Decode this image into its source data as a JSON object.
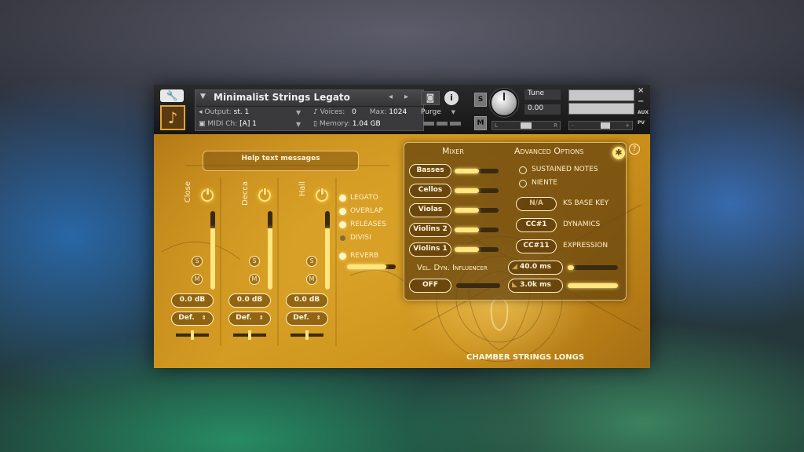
{
  "header": {
    "instrument_name": "Minimalist Strings Legato",
    "nav_prev": "◂",
    "nav_next": "▸",
    "output_label": "Output:",
    "output_value": "st. 1",
    "midi_label": "MIDI Ch:",
    "midi_value": "[A] 1",
    "voices_label": "Voices:",
    "voices_value": "0",
    "max_label": "Max:",
    "max_value": "1024",
    "memory_label": "Memory:",
    "memory_value": "1.04 GB",
    "purge_label": "Purge",
    "solo_label": "S",
    "mute_label": "M",
    "tune_label": "Tune",
    "tune_value": "0.00",
    "pan_left": "L",
    "pan_right": "R",
    "vol_minus": "-",
    "vol_plus": "+",
    "close_x": "×",
    "minimize": "−",
    "aux_label": "AUX",
    "pv_label": "PV"
  },
  "help": {
    "text": "Help text messages"
  },
  "mics": [
    {
      "name": "Close",
      "level": 0.78,
      "db": "0.0 dB",
      "preset": "Def."
    },
    {
      "name": "Decca",
      "level": 0.78,
      "db": "0.0 dB",
      "preset": "Def."
    },
    {
      "name": "Hall",
      "level": 0.78,
      "db": "0.0 dB",
      "preset": "Def."
    }
  ],
  "mic_solo": "S",
  "mic_mute": "M",
  "options": [
    {
      "label": "LEGATO",
      "on": true
    },
    {
      "label": "OVERLAP",
      "on": true
    },
    {
      "label": "RELEASES",
      "on": true
    },
    {
      "label": "DIVISI",
      "on": false
    },
    {
      "label": "REVERB",
      "on": true
    }
  ],
  "reverb_level": 0.8,
  "mixer": {
    "title": "Mixer",
    "sections": [
      {
        "label": "Basses",
        "level": 0.55
      },
      {
        "label": "Cellos",
        "level": 0.55
      },
      {
        "label": "Violas",
        "level": 0.55
      },
      {
        "label": "Violins 2",
        "level": 0.55
      },
      {
        "label": "Violins 1",
        "level": 0.55
      }
    ],
    "influencer_label": "Vel. Dyn. Influencer",
    "influencer_value": "OFF"
  },
  "advanced": {
    "title": "Advanced Options",
    "radio_sustained": "SUSTAINED NOTES",
    "radio_niente": "NIENTE",
    "ks_value": "N/A",
    "ks_label": "KS BASE KEY",
    "dynamics_cc": "CC#1",
    "dynamics_label": "DYNAMICS",
    "expression_cc": "CC#11",
    "expression_label": "EXPRESSION",
    "attack_value": "40.0 ms",
    "attack_level": 0.12,
    "release_value": "3.0k ms",
    "release_level": 1.0
  },
  "brand": "CHAMBER STRINGS LONGS",
  "help_icon": "?",
  "colors": {
    "accent": "#ffe680",
    "panel": "#6a4610",
    "text": "#fff0cc"
  }
}
